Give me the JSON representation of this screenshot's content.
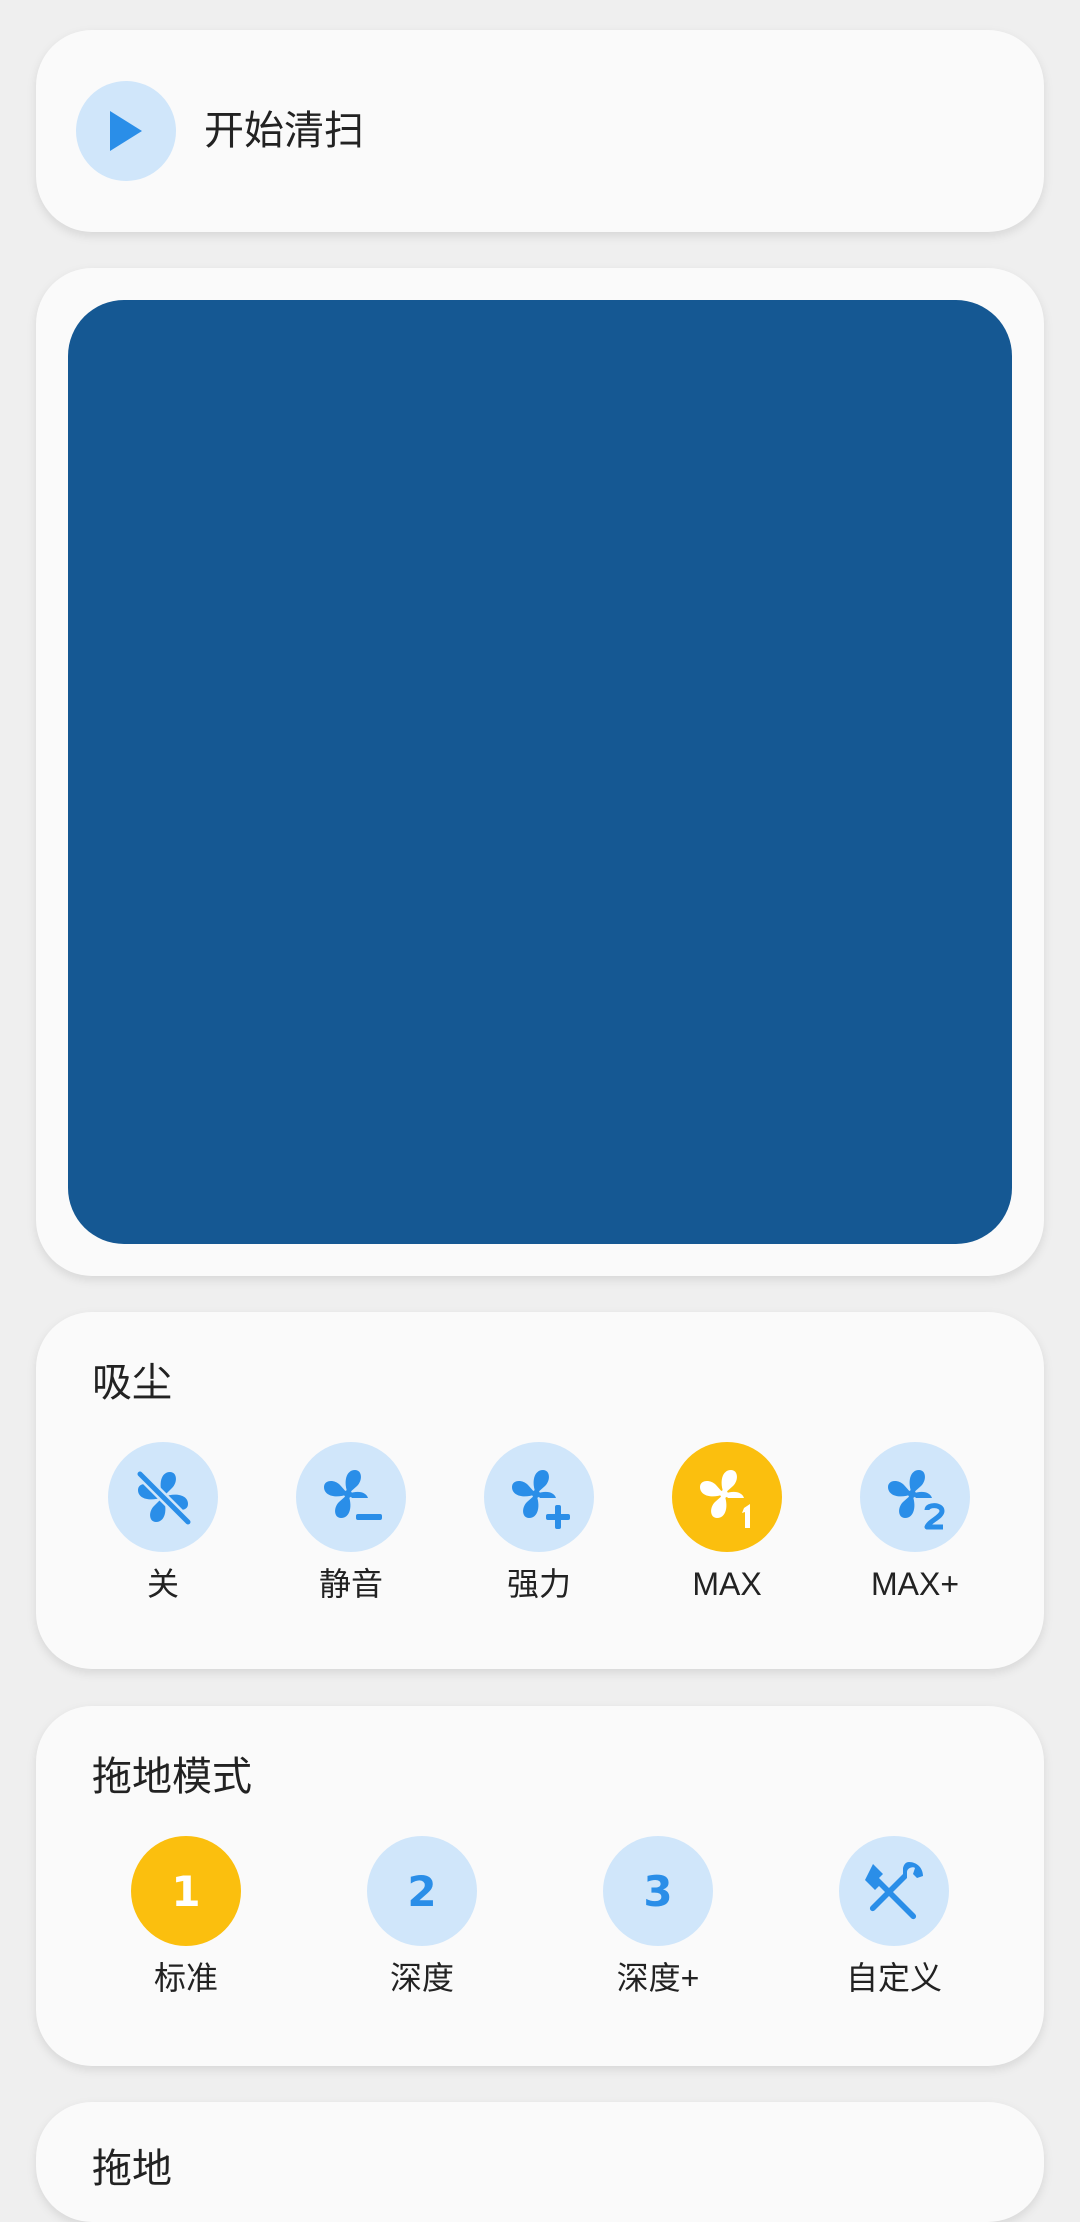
{
  "colors": {
    "background": "#efefef",
    "card": "#fafafa",
    "accent_blue": "#2a8ee8",
    "icon_bg": "#d0e6fa",
    "selected": "#fbbf0e",
    "map": "#155893"
  },
  "start": {
    "label": "开始清扫",
    "icon": "play-icon"
  },
  "map": {
    "color": "#155893"
  },
  "suction": {
    "title": "吸尘",
    "options": [
      {
        "label": "关",
        "icon": "fan-off-icon",
        "selected": false
      },
      {
        "label": "静音",
        "icon": "fan-minus-icon",
        "selected": false
      },
      {
        "label": "强力",
        "icon": "fan-plus-icon",
        "selected": false
      },
      {
        "label": "MAX",
        "icon": "fan-1-icon",
        "selected": true
      },
      {
        "label": "MAX+",
        "icon": "fan-2-icon",
        "selected": false
      }
    ]
  },
  "mop": {
    "title": "拖地模式",
    "options": [
      {
        "label": "标准",
        "glyph": "1",
        "icon": "number-1-icon",
        "selected": true
      },
      {
        "label": "深度",
        "glyph": "2",
        "icon": "number-2-icon",
        "selected": false
      },
      {
        "label": "深度+",
        "glyph": "3",
        "icon": "number-3-icon",
        "selected": false
      },
      {
        "label": "自定义",
        "icon": "tools-icon",
        "selected": false
      }
    ]
  },
  "next_section": {
    "title": "拖地"
  }
}
